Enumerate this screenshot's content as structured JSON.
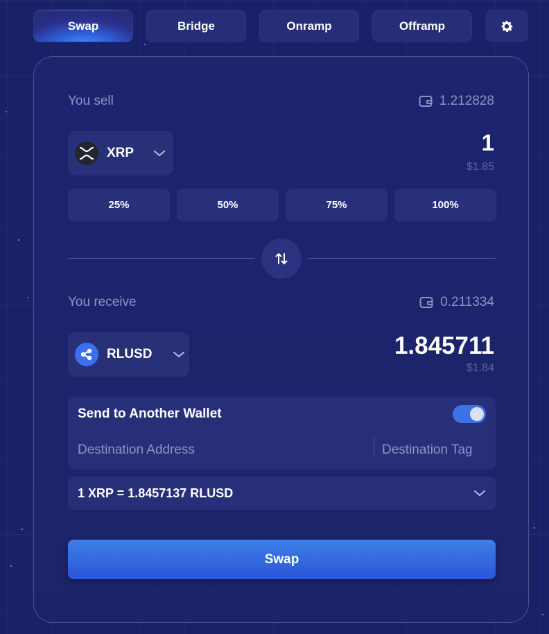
{
  "tabs": [
    {
      "label": "Swap",
      "active": true
    },
    {
      "label": "Bridge",
      "active": false
    },
    {
      "label": "Onramp",
      "active": false
    },
    {
      "label": "Offramp",
      "active": false
    }
  ],
  "settings_icon": "gear-icon",
  "sell": {
    "label": "You sell",
    "balance": "1.212828",
    "token": "XRP",
    "amount": "1",
    "usd": "$1.85"
  },
  "percent_buttons": [
    "25%",
    "50%",
    "75%",
    "100%"
  ],
  "receive": {
    "label": "You receive",
    "balance": "0.211334",
    "token": "RLUSD",
    "amount": "1.845711",
    "usd": "$1.84"
  },
  "send_wallet": {
    "title": "Send to Another Wallet",
    "enabled": true,
    "address_placeholder": "Destination Address",
    "tag_placeholder": "Destination Tag"
  },
  "rate": "1 XRP = 1.8457137 RLUSD",
  "swap_button": "Swap",
  "colors": {
    "background": "#1a2168",
    "card": "#1d2470",
    "accent": "#3d72e6",
    "muted_text": "#8d93c4"
  }
}
